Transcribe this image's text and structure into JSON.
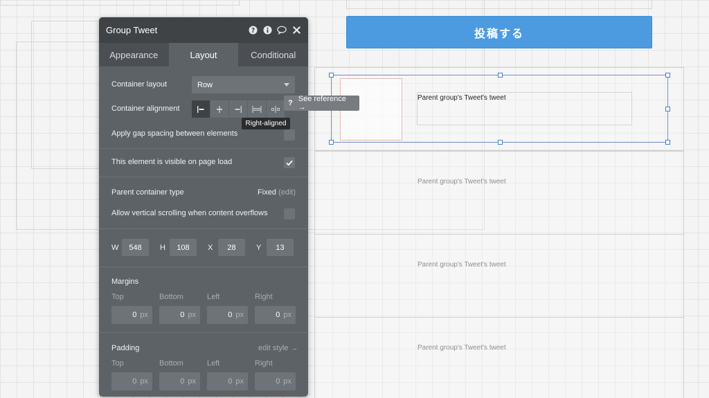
{
  "canvas": {
    "post_button_label": "投稿する",
    "tweet_text": "Parent group's Tweet's tweet"
  },
  "panel": {
    "title": "Group Tweet",
    "icons": [
      "help-icon",
      "info-icon",
      "comment-icon",
      "close-icon"
    ],
    "tabs": [
      {
        "label": "Appearance",
        "active": false
      },
      {
        "label": "Layout",
        "active": true
      },
      {
        "label": "Conditional",
        "active": false
      }
    ],
    "container_layout_label": "Container layout",
    "container_layout_value": "Row",
    "container_alignment_label": "Container alignment",
    "alignment_options": [
      "left-aligned",
      "center-aligned",
      "right-aligned",
      "space-between",
      "space-around"
    ],
    "alignment_selected": "left-aligned",
    "gap_spacing_label": "Apply gap spacing between elements",
    "visible_label": "This element is visible on page load",
    "visible_checked": true,
    "parent_container_type_label": "Parent container type",
    "parent_container_type_value": "Fixed",
    "parent_container_type_edit": "(edit)",
    "scroll_label": "Allow vertical scrolling when content overflows",
    "dims": {
      "w_label": "W",
      "w": "548",
      "h_label": "H",
      "h": "108",
      "x_label": "X",
      "x": "28",
      "y_label": "Y",
      "y": "13"
    },
    "margins": {
      "title": "Margins",
      "top_label": "Top",
      "bottom_label": "Bottom",
      "left_label": "Left",
      "right_label": "Right",
      "top": "0",
      "bottom": "0",
      "left": "0",
      "right": "0",
      "unit": "px"
    },
    "padding": {
      "title": "Padding",
      "edit_style": "edit style →",
      "top_label": "Top",
      "bottom_label": "Bottom",
      "left_label": "Left",
      "right_label": "Right",
      "top": "0",
      "bottom": "0",
      "left": "0",
      "right": "0",
      "unit": "px"
    }
  },
  "tooltips": {
    "see_reference_q": "?",
    "see_reference": "See reference →",
    "alignment_hover": "Right-aligned"
  },
  "colors": {
    "panel_bg": "#5d6266",
    "panel_header": "#3f4346",
    "accent_button": "#4c9be0",
    "selection": "#4a7bd0"
  }
}
